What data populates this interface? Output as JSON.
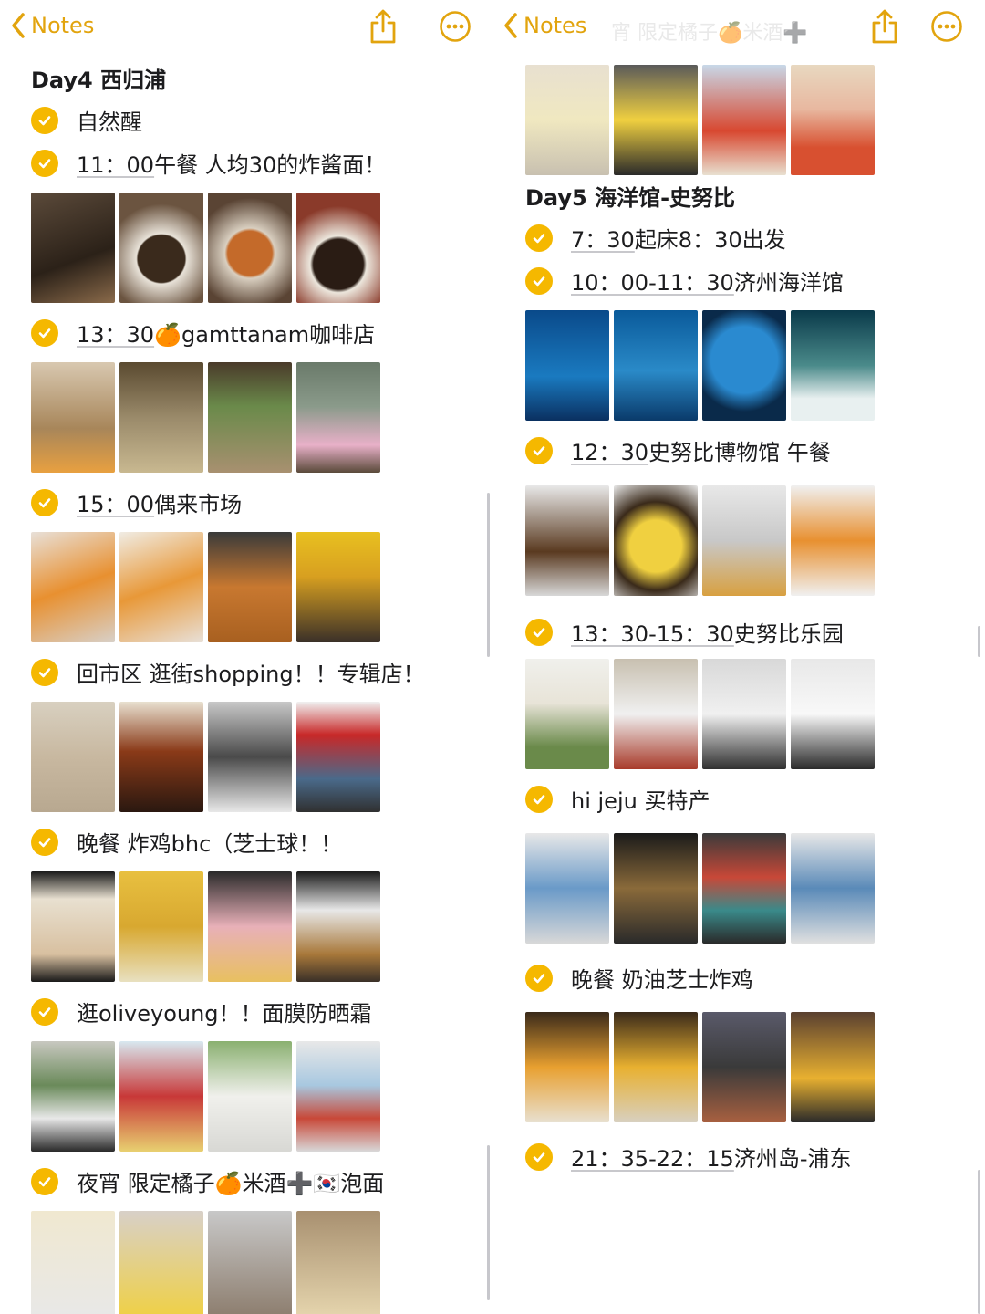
{
  "left": {
    "back_label": "Notes",
    "heading": "Day4 西归浦",
    "items": [
      {
        "time": "",
        "text": "自然醒"
      },
      {
        "time": "11：00",
        "text": "午餐 人均30的炸酱面！"
      },
      {
        "time": "13：30",
        "text": "🍊gamttanam咖啡店"
      },
      {
        "time": "15：00",
        "text": "偶来市场"
      },
      {
        "time": "",
        "text": "回市区 逛街shopping！！专辑店！"
      },
      {
        "time": "",
        "text": "晚餐 炸鸡bhc（芝士球！！"
      },
      {
        "time": "",
        "text": "逛oliveyoung！！面膜防晒霜"
      },
      {
        "time": "",
        "text": "夜宵 限定橘子🍊米酒➕🇰🇷泡面"
      }
    ]
  },
  "right": {
    "back_label": "Notes",
    "ghost_title": "宵 限定橘子🍊米酒➕",
    "heading": "Day5 海洋馆-史努比",
    "items": [
      {
        "time": "7：30",
        "text": "起床8：30出发"
      },
      {
        "time": "10：00-11：30",
        "text": "济州海洋馆"
      },
      {
        "time": "12：30",
        "text": "史努比博物馆 午餐"
      },
      {
        "time": "13：30-15：30",
        "text": "史努比乐园"
      },
      {
        "time": "",
        "text": "hi jeju 买特产"
      },
      {
        "time": "",
        "text": "晚餐 奶油芝士炸鸡"
      },
      {
        "time": "21：35-22：15",
        "text": "济州岛-浦东"
      }
    ]
  },
  "colors": {
    "accent": "#f5b800",
    "back": "#e2a40e"
  },
  "icons": {
    "back": "chevron-left-icon",
    "share": "share-icon",
    "more": "ellipsis-circle-icon",
    "check": "checkmark-circle-icon"
  }
}
